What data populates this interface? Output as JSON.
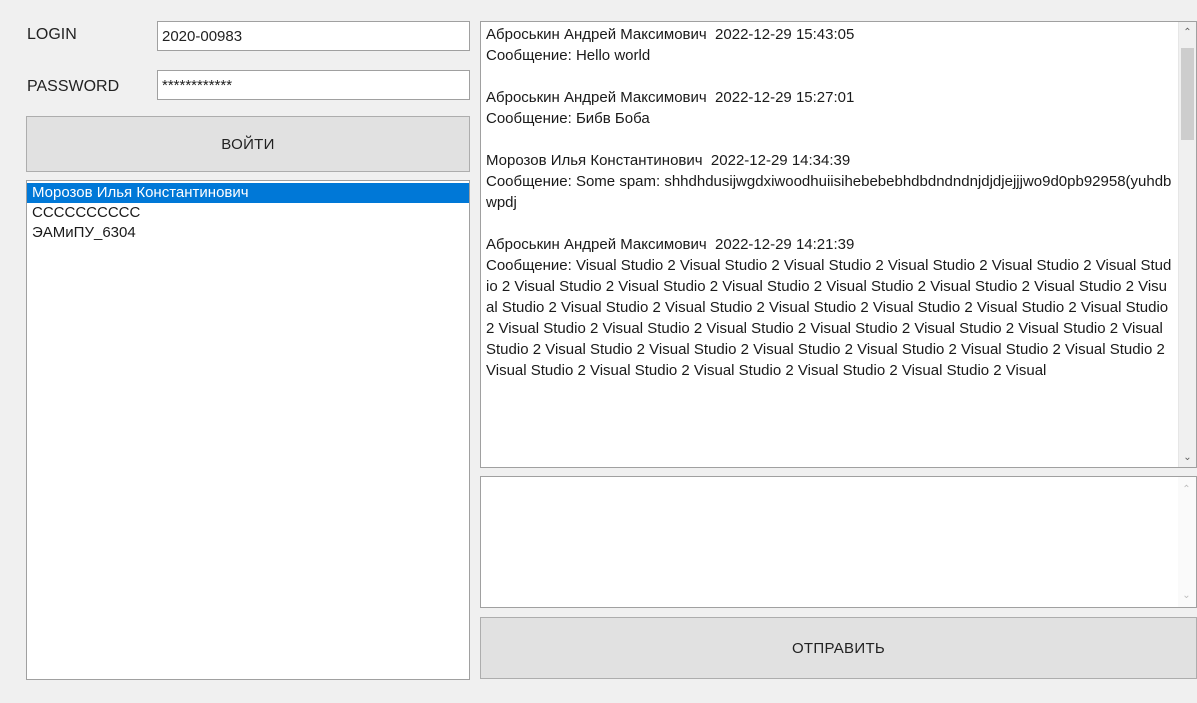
{
  "login": {
    "label": "LOGIN",
    "value": "2020-00983"
  },
  "password": {
    "label": "PASSWORD",
    "value": "************"
  },
  "login_button": {
    "label": "ВОЙТИ"
  },
  "users": [
    {
      "name": "Морозов Илья Константинович",
      "selected": true
    },
    {
      "name": "CCCCCCCCCC",
      "selected": false
    },
    {
      "name": "ЭАМиПУ_6304",
      "selected": false
    }
  ],
  "messages": [
    {
      "author": "Аброськин Андрей Максимович",
      "timestamp": "2022-12-29 15:43:05",
      "text": "Сообщение: Hello world"
    },
    {
      "author": "Аброськин Андрей Максимович",
      "timestamp": "2022-12-29 15:27:01",
      "text": "Сообщение: Бибв Боба"
    },
    {
      "author": "Морозов Илья Константинович",
      "timestamp": "2022-12-29 14:34:39",
      "text": "Сообщение: Some spam: shhdhdusijwgdxiwoodhuiisihebebebhdbdndndnjdjdjejjjwo9d0pb92958(yuhdbwpdj"
    },
    {
      "author": "Аброськин Андрей Максимович",
      "timestamp": "2022-12-29 14:21:39",
      "text": "Сообщение: Visual Studio 2 Visual Studio 2 Visual Studio 2 Visual Studio 2 Visual Studio 2 Visual Studio 2 Visual Studio 2 Visual Studio 2 Visual Studio 2 Visual Studio 2 Visual Studio 2 Visual Studio 2 Visual Studio 2 Visual Studio 2 Visual Studio 2 Visual Studio 2 Visual Studio 2 Visual Studio 2 Visual Studio 2 Visual Studio 2 Visual Studio 2 Visual Studio 2 Visual Studio 2 Visual Studio 2 Visual Studio 2 Visual Studio 2 Visual Studio 2 Visual Studio 2 Visual Studio 2 Visual Studio 2 Visual Studio 2 Visual Studio 2 Visual Studio 2 Visual Studio 2 Visual Studio 2 Visual Studio 2 Visual Studio 2 Visual"
    }
  ],
  "compose": {
    "value": ""
  },
  "send_button": {
    "label": "ОТПРАВИТЬ"
  },
  "colors": {
    "selection": "#0078d7",
    "window_bg": "#f0f0f0",
    "button_bg": "#e1e1e1"
  }
}
